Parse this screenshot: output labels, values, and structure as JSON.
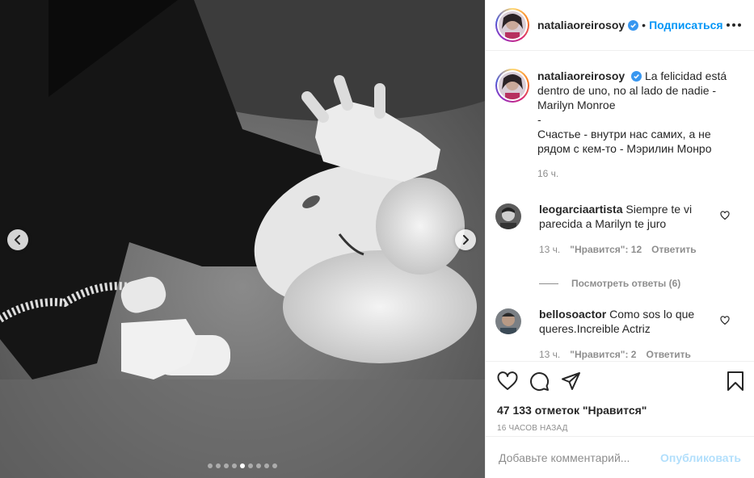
{
  "post": {
    "username": "nataliaoreirosoy",
    "follow_label": "Подписаться",
    "separator": "•",
    "carousel": {
      "total": 9,
      "active": 4
    }
  },
  "caption": {
    "username": "nataliaoreirosoy",
    "lines": [
      "La felicidad está",
      "dentro de uno, no al lado de nadie -",
      "Marilyn Monroe",
      "-",
      "Счастье - внутри нас самих, а не",
      "рядом с кем-то - Мэрилин Монро"
    ],
    "time": "16 ч."
  },
  "comments": [
    {
      "username": "leogarciaartista",
      "line1": "Siempre te vi",
      "line2": "parecida a Marilyn te juro",
      "time": "13 ч.",
      "likes": "\"Нравится\": 12",
      "reply": "Ответить",
      "view_replies": "Посмотреть ответы (6)"
    },
    {
      "username": "bellosoactor",
      "line1": "Como sos lo que",
      "line2": "queres.Increible Actriz",
      "time": "13 ч.",
      "likes": "\"Нравится\": 2",
      "reply": "Ответить"
    }
  ],
  "stats": {
    "likes": "47 133 отметок \"Нравится\"",
    "posted": "16 ЧАСОВ НАЗАД"
  },
  "composer": {
    "placeholder": "Добавьте комментарий...",
    "publish_label": "Опубликовать"
  },
  "icons": [
    "chevron-left-icon",
    "chevron-right-icon",
    "verified-icon",
    "more-icon",
    "heart-icon",
    "comment-icon",
    "share-icon",
    "bookmark-icon"
  ],
  "colors": {
    "accent": "#0095f6",
    "publish_disabled": "#b2dffc",
    "muted": "#8e8e8e",
    "text": "#262626"
  }
}
